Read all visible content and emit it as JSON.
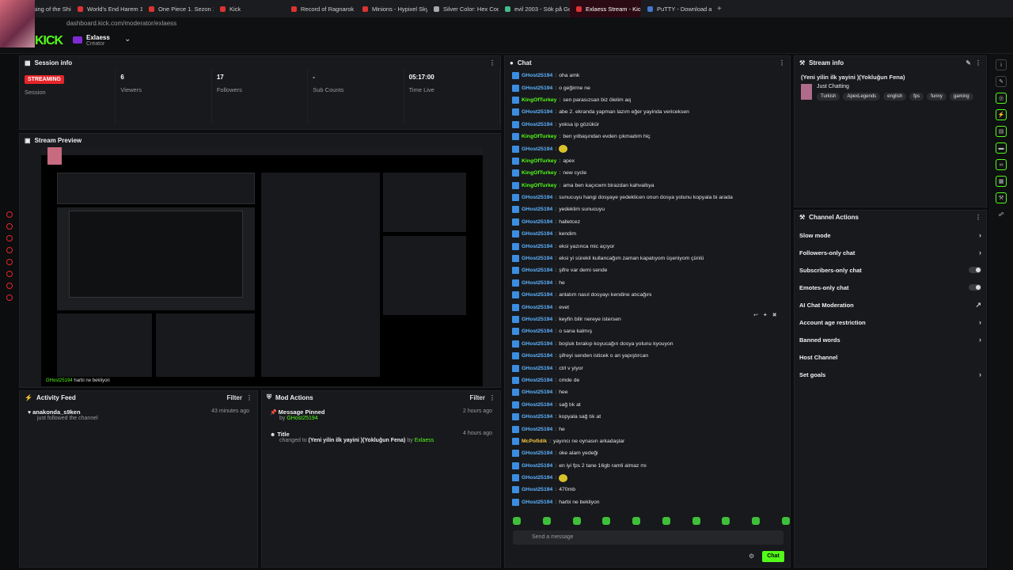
{
  "tabs": [
    {
      "label": "The Rising of the Shield H",
      "color": "#d33"
    },
    {
      "label": "World's End Harem 1. Se",
      "color": "#d33"
    },
    {
      "label": "One Piece 1. Sezon 1155.",
      "color": "#d33"
    },
    {
      "label": "Kick",
      "color": "#d33"
    },
    {
      "label": "Record of Ragnarok 1. Se",
      "color": "#d33"
    },
    {
      "label": "Minions - Hypixel SkyBloc",
      "color": "#d33"
    },
    {
      "label": "Silver Color: Hex Code, Pa",
      "color": "#aaa"
    },
    {
      "label": "evil 2003 - Sök på Google",
      "color": "#4b8"
    },
    {
      "label": "Exlaess Stream - Kick Da",
      "color": "#d33",
      "active": true
    },
    {
      "label": "PuTTY - Download and ins",
      "color": "#47c"
    }
  ],
  "url": "dashboard.kick.com/moderator/exlaess",
  "logo": "KICK",
  "channel": {
    "name": "Exlaess",
    "role": "Creator"
  },
  "session": {
    "title": "Session info",
    "badge": "STREAMING",
    "stats": [
      {
        "value": "",
        "label": "Session"
      },
      {
        "value": "6",
        "label": "Viewers"
      },
      {
        "value": "17",
        "label": "Followers"
      },
      {
        "value": "-",
        "label": "Sub Counts"
      },
      {
        "value": "05:17:00",
        "label": "Time Live"
      }
    ]
  },
  "preview": {
    "title": "Stream Preview",
    "overlay_user": "GHost25194",
    "overlay_text": "harbi ne bekliyon"
  },
  "activity": {
    "title": "Activity Feed",
    "filter": "Filter",
    "items": [
      {
        "user": "anakonda_s9ken",
        "sub": "just followed the channel",
        "time": "43 minutes ago"
      }
    ]
  },
  "mod": {
    "title": "Mod Actions",
    "filter": "Filter",
    "items": [
      {
        "title": "Message Pinned",
        "by": "by",
        "user": "GHost25194",
        "time": "2 hours ago"
      },
      {
        "title": "Title",
        "by": "changed to",
        "text": "(Yeni yilin ilk yayini )(Yokluğun Fena)",
        "by2": "by",
        "user": "Exlaess",
        "time": "4 hours ago"
      }
    ]
  },
  "chat": {
    "title": "Chat",
    "placeholder": "Send a message",
    "send": "Chat",
    "messages": [
      {
        "user": "GHost25194",
        "color": "#5fb3ff",
        "text": "oha amk"
      },
      {
        "user": "GHost25194",
        "color": "#5fb3ff",
        "text": "o geğirme ne"
      },
      {
        "user": "KingOfTurkey",
        "color": "#53fc18",
        "text": "sen parasızsan biz ölelim aq"
      },
      {
        "user": "GHost25194",
        "color": "#5fb3ff",
        "text": "abe 2. ekranda yapman lazım eğer yayinda vericeksen"
      },
      {
        "user": "GHost25194",
        "color": "#5fb3ff",
        "text": "yoksa ip gözükür"
      },
      {
        "user": "KingOfTurkey",
        "color": "#53fc18",
        "text": "ben yılbaşından evden çıkmadım hiç"
      },
      {
        "user": "GHost25194",
        "color": "#5fb3ff",
        "text": "",
        "emoji": true
      },
      {
        "user": "KingOfTurkey",
        "color": "#53fc18",
        "text": "apex"
      },
      {
        "user": "KingOfTurkey",
        "color": "#53fc18",
        "text": "new cycle"
      },
      {
        "user": "KingOfTurkey",
        "color": "#53fc18",
        "text": "ama ben kaçıcwm birazdan kahvaltıya"
      },
      {
        "user": "GHost25194",
        "color": "#5fb3ff",
        "text": "sunucuyu hangi dosyaye yedeklicen onun dosya yolunu kopyala bi arada"
      },
      {
        "user": "GHost25194",
        "color": "#5fb3ff",
        "text": "yedeklim sunucuyu"
      },
      {
        "user": "GHost25194",
        "color": "#5fb3ff",
        "text": "halletcez"
      },
      {
        "user": "GHost25194",
        "color": "#5fb3ff",
        "text": "kendim"
      },
      {
        "user": "GHost25194",
        "color": "#5fb3ff",
        "text": "eksi yazınca mic açıyor"
      },
      {
        "user": "GHost25194",
        "color": "#5fb3ff",
        "text": "eksi yi sürekli kullancağım zaman kapatıyom üşeniyom çünlü"
      },
      {
        "user": "GHost25194",
        "color": "#5fb3ff",
        "text": "şifre var demi sende"
      },
      {
        "user": "GHost25194",
        "color": "#5fb3ff",
        "text": "he"
      },
      {
        "user": "GHost25194",
        "color": "#5fb3ff",
        "text": "anlatım nasıl dosyayı kendine atıcağını"
      },
      {
        "user": "GHost25194",
        "color": "#5fb3ff",
        "text": "evet"
      },
      {
        "user": "GHost25194",
        "color": "#5fb3ff",
        "text": "keyfin bilir nereye istersen"
      },
      {
        "user": "GHost25194",
        "color": "#5fb3ff",
        "text": "o sana kalmış"
      },
      {
        "user": "GHost25194",
        "color": "#5fb3ff",
        "text": "boşluk bırakıp koyucağın dosya yolunu kyouyon"
      },
      {
        "user": "GHost25194",
        "color": "#5fb3ff",
        "text": "şifreyi senden isticek o an yapıştırcan"
      },
      {
        "user": "GHost25194",
        "color": "#5fb3ff",
        "text": "ctrl v yiyor"
      },
      {
        "user": "GHost25194",
        "color": "#5fb3ff",
        "text": "cmde de"
      },
      {
        "user": "GHost25194",
        "color": "#5fb3ff",
        "text": "hee"
      },
      {
        "user": "GHost25194",
        "color": "#5fb3ff",
        "text": "sağ tık at"
      },
      {
        "user": "GHost25194",
        "color": "#5fb3ff",
        "text": "kopyala sağ tık at"
      },
      {
        "user": "GHost25194",
        "color": "#5fb3ff",
        "text": "he"
      },
      {
        "user": "McPofidik",
        "color": "#f5c542",
        "text": "yayıncı ne oynasın arkadaşlar"
      },
      {
        "user": "GHost25194",
        "color": "#5fb3ff",
        "text": "oke alam yedeği"
      },
      {
        "user": "GHost25194",
        "color": "#5fb3ff",
        "text": "en iyi fps 2 tane 16gb ramli almaz mı"
      },
      {
        "user": "GHost25194",
        "color": "#5fb3ff",
        "text": "",
        "emoji": true
      },
      {
        "user": "GHost25194",
        "color": "#5fb3ff",
        "text": "470mb"
      },
      {
        "user": "GHost25194",
        "color": "#5fb3ff",
        "text": "harbi ne bekliyon"
      }
    ]
  },
  "streaminfo": {
    "title": "Stream info",
    "stream_title": "(Yeni yilin ilk yayini )(Yokluğun Fena)",
    "category": "Just Chatting",
    "tags": [
      "Turkish",
      "ApexLegends",
      "english",
      "fps",
      "funny",
      "gaming"
    ]
  },
  "actions": {
    "title": "Channel Actions",
    "items": [
      {
        "label": "Slow mode",
        "ctrl": "arrow"
      },
      {
        "label": "Followers-only chat",
        "ctrl": "arrow"
      },
      {
        "label": "Subscribers-only chat",
        "ctrl": "toggle"
      },
      {
        "label": "Emotes-only chat",
        "ctrl": "toggle"
      },
      {
        "label": "AI Chat Moderation",
        "ctrl": "ext"
      },
      {
        "label": "Account age restriction",
        "ctrl": "arrow"
      },
      {
        "label": "Banned words",
        "ctrl": "arrow"
      },
      {
        "label": "Host Channel",
        "ctrl": "none"
      },
      {
        "label": "Set goals",
        "ctrl": "arrow"
      }
    ]
  }
}
